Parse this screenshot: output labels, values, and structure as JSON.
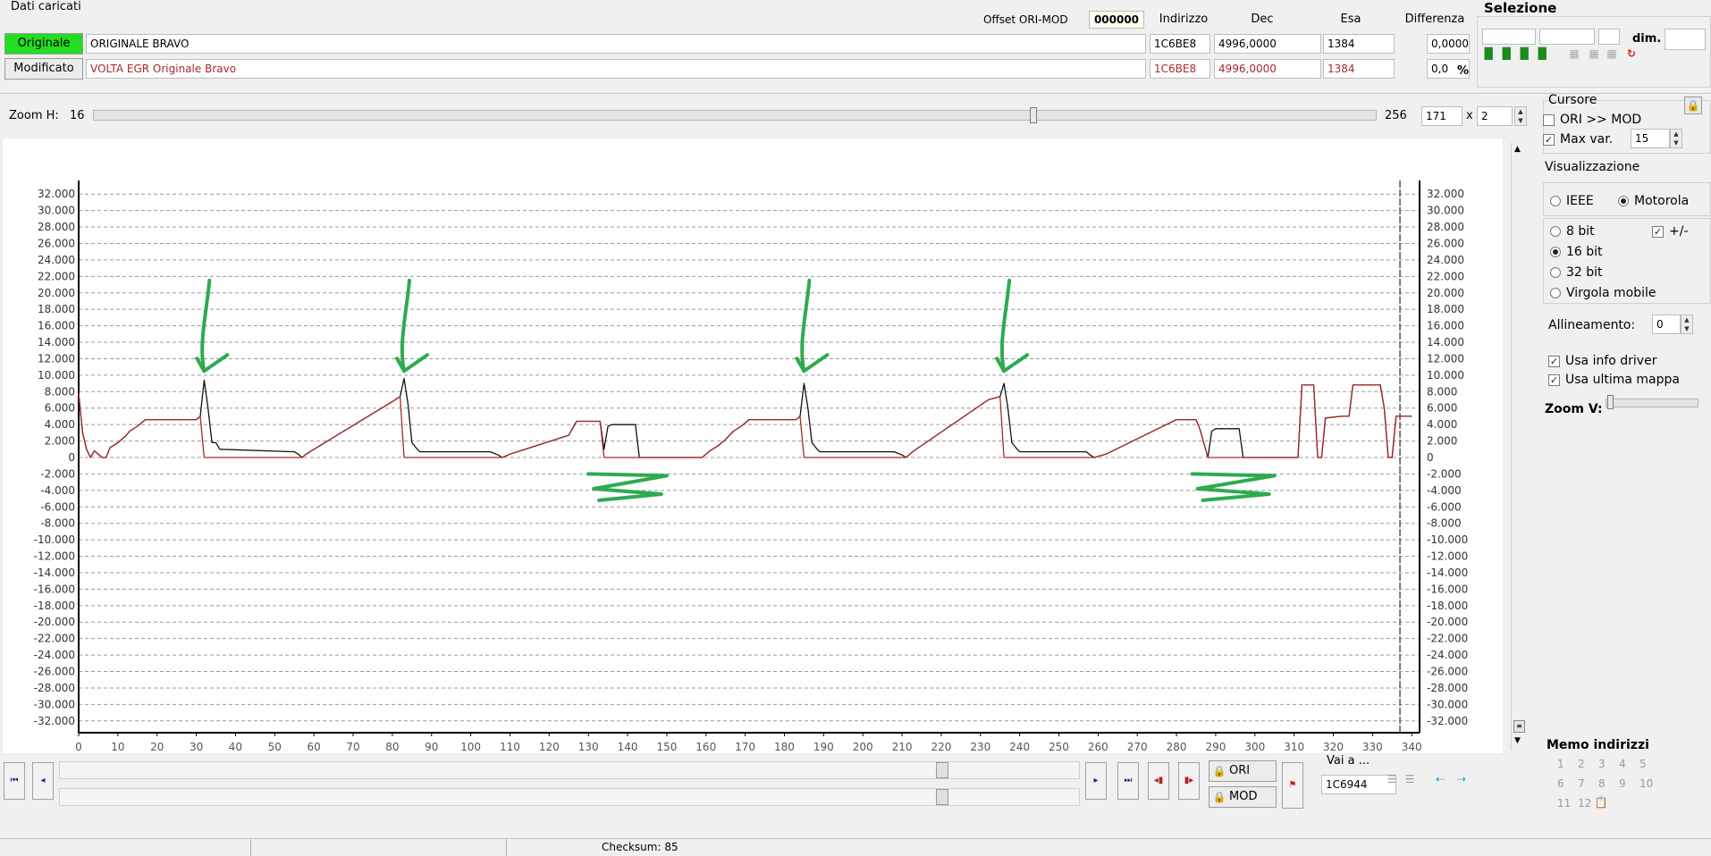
{
  "loaded": {
    "title": "Dati caricati",
    "offset_label": "Offset ORI-MOD",
    "offset_value": "000000",
    "headers": {
      "address": "Indirizzo",
      "dec": "Dec",
      "hex": "Esa",
      "diff": "Differenza"
    },
    "original": {
      "button": "Originale",
      "name": "ORIGINALE BRAVO",
      "address": "1C6BE8",
      "dec": "4996,0000",
      "hex": "1384",
      "diff": "0,0000"
    },
    "modified": {
      "button": "Modificato",
      "name": "VOLTA EGR Originale Bravo",
      "address": "1C6BE8",
      "dec": "4996,0000",
      "hex": "1384",
      "diff": "0,0",
      "unit": "%"
    }
  },
  "selection": {
    "title": "Selezione",
    "dim_label": "dim."
  },
  "zoom_h": {
    "label": "Zoom H:",
    "min": "16",
    "max": "256",
    "value": "171",
    "times": "x",
    "multiplier": "2",
    "level": 0.73
  },
  "cursor": {
    "title": "Cursore",
    "ori_mod": "ORI >> MOD",
    "ori_mod_checked": false,
    "max_var": "Max var.",
    "max_var_checked": true,
    "max_var_value": "15"
  },
  "visualization": {
    "title": "Visualizzazione",
    "ieee": "IEEE",
    "motorola": "Motorola",
    "byte_order": "Motorola",
    "bits": [
      "8 bit",
      "16 bit",
      "32 bit",
      "Virgola mobile"
    ],
    "selected_bits": "16 bit",
    "sign": "+/-",
    "sign_checked": true,
    "alignment_label": "Allineamento:",
    "alignment_value": "0",
    "use_driver": "Usa info driver",
    "use_driver_checked": true,
    "use_last_map": "Usa ultima mappa",
    "use_last_map_checked": true,
    "zoom_v": "Zoom V:"
  },
  "bottom": {
    "ori_button": "ORI",
    "mod_button": "MOD",
    "goto_label": "Vai a ...",
    "goto_value": "1C6944",
    "memo_title": "Memo indirizzi",
    "memo_slots": [
      "1",
      "2",
      "3",
      "4",
      "5",
      "6",
      "7",
      "8",
      "9",
      "10",
      "11",
      "12"
    ],
    "checksum": "Checksum: 85"
  },
  "chart_data": {
    "type": "line",
    "x_ticks": [
      0,
      10,
      20,
      30,
      40,
      50,
      60,
      70,
      80,
      90,
      100,
      110,
      120,
      130,
      140,
      150,
      160,
      170,
      180,
      190,
      200,
      210,
      220,
      230,
      240,
      250,
      260,
      270,
      280,
      290,
      300,
      310,
      320,
      330,
      340
    ],
    "y_ticks": [
      32000,
      30000,
      28000,
      26000,
      24000,
      22000,
      20000,
      18000,
      16000,
      14000,
      12000,
      10000,
      8000,
      6000,
      4000,
      2000,
      0,
      -2000,
      -4000,
      -6000,
      -8000,
      -10000,
      -12000,
      -14000,
      -16000,
      -18000,
      -20000,
      -22000,
      -24000,
      -26000,
      -28000,
      -30000,
      -32000
    ],
    "y_tick_labels": [
      "32.000",
      "30.000",
      "28.000",
      "26.000",
      "24.000",
      "22.000",
      "20.000",
      "18.000",
      "16.000",
      "14.000",
      "12.000",
      "10.000",
      "8.000",
      "6.000",
      "4.000",
      "2.000",
      "0",
      "-2.000",
      "-4.000",
      "-6.000",
      "-8.000",
      "-10.000",
      "-12.000",
      "-14.000",
      "-16.000",
      "-18.000",
      "-20.000",
      "-22.000",
      "-24.000",
      "-26.000",
      "-28.000",
      "-30.000",
      "-32.000"
    ],
    "xlim": [
      0,
      342
    ],
    "ylim": [
      -33000,
      33000
    ],
    "grid": true,
    "cursor_x": 337,
    "series": [
      {
        "color": "#111111",
        "points": [
          [
            0,
            7800
          ],
          [
            1,
            3000
          ],
          [
            2,
            1000
          ],
          [
            3,
            0
          ],
          [
            4,
            800
          ],
          [
            6,
            0
          ],
          [
            7,
            0
          ],
          [
            8,
            1200
          ],
          [
            10,
            1800
          ],
          [
            12,
            2600
          ],
          [
            13,
            3200
          ],
          [
            15,
            3800
          ],
          [
            17,
            4600
          ],
          [
            30,
            4600
          ],
          [
            31,
            5000
          ],
          [
            32,
            9400
          ],
          [
            33,
            6000
          ],
          [
            34,
            1800
          ],
          [
            35,
            1800
          ],
          [
            36,
            1000
          ],
          [
            55,
            700
          ],
          [
            56,
            400
          ],
          [
            57,
            0
          ],
          [
            58,
            400
          ],
          [
            60,
            1000
          ],
          [
            80,
            6800
          ],
          [
            82,
            7400
          ],
          [
            83,
            9600
          ],
          [
            84,
            6500
          ],
          [
            85,
            1800
          ],
          [
            86,
            1200
          ],
          [
            87,
            700
          ],
          [
            105,
            700
          ],
          [
            107,
            300
          ],
          [
            108,
            0
          ],
          [
            110,
            400
          ],
          [
            125,
            2700
          ],
          [
            127,
            4400
          ],
          [
            133,
            4400
          ],
          [
            134,
            1000
          ],
          [
            135,
            3800
          ],
          [
            136,
            4000
          ],
          [
            142,
            4000
          ],
          [
            143,
            0
          ],
          [
            147,
            0
          ],
          [
            153,
            0
          ],
          [
            159,
            0
          ],
          [
            161,
            800
          ],
          [
            163,
            1400
          ],
          [
            165,
            2200
          ],
          [
            167,
            3200
          ],
          [
            169,
            3800
          ],
          [
            171,
            4600
          ],
          [
            183,
            4600
          ],
          [
            184,
            5000
          ],
          [
            185,
            9000
          ],
          [
            186,
            6000
          ],
          [
            187,
            1800
          ],
          [
            188,
            1200
          ],
          [
            189,
            700
          ],
          [
            208,
            700
          ],
          [
            210,
            300
          ],
          [
            211,
            0
          ],
          [
            213,
            800
          ],
          [
            232,
            7000
          ],
          [
            235,
            7400
          ],
          [
            236,
            9000
          ],
          [
            237,
            6000
          ],
          [
            238,
            1800
          ],
          [
            239,
            1200
          ],
          [
            240,
            700
          ],
          [
            257,
            700
          ],
          [
            258,
            300
          ],
          [
            259,
            0
          ],
          [
            262,
            400
          ],
          [
            280,
            4600
          ],
          [
            285,
            4600
          ],
          [
            286,
            3400
          ],
          [
            288,
            0
          ],
          [
            289,
            3200
          ],
          [
            290,
            3500
          ],
          [
            296,
            3500
          ],
          [
            297,
            0
          ],
          [
            305,
            0
          ],
          [
            311,
            0
          ],
          [
            312,
            8800
          ],
          [
            315,
            8800
          ],
          [
            316,
            0
          ],
          [
            317,
            0
          ],
          [
            318,
            4800
          ],
          [
            322,
            5000
          ],
          [
            324,
            5000
          ],
          [
            325,
            8800
          ],
          [
            332,
            8800
          ],
          [
            333,
            6000
          ],
          [
            334,
            0
          ],
          [
            335,
            0
          ],
          [
            336,
            5000
          ],
          [
            340,
            5000
          ]
        ]
      },
      {
        "color": "#a52a2a",
        "points": [
          [
            0,
            7800
          ],
          [
            1,
            3000
          ],
          [
            2,
            1000
          ],
          [
            3,
            0
          ],
          [
            4,
            800
          ],
          [
            6,
            0
          ],
          [
            7,
            0
          ],
          [
            8,
            1200
          ],
          [
            10,
            1800
          ],
          [
            12,
            2600
          ],
          [
            13,
            3200
          ],
          [
            15,
            3800
          ],
          [
            17,
            4600
          ],
          [
            30,
            4600
          ],
          [
            31,
            5000
          ],
          [
            32,
            0
          ],
          [
            57,
            0
          ],
          [
            58,
            400
          ],
          [
            60,
            1000
          ],
          [
            80,
            6800
          ],
          [
            82,
            7400
          ],
          [
            83,
            0
          ],
          [
            108,
            0
          ],
          [
            110,
            400
          ],
          [
            125,
            2700
          ],
          [
            127,
            4400
          ],
          [
            133,
            4400
          ],
          [
            134,
            0
          ],
          [
            159,
            0
          ],
          [
            161,
            800
          ],
          [
            163,
            1400
          ],
          [
            165,
            2200
          ],
          [
            167,
            3200
          ],
          [
            169,
            3800
          ],
          [
            171,
            4600
          ],
          [
            183,
            4600
          ],
          [
            184,
            5000
          ],
          [
            185,
            0
          ],
          [
            211,
            0
          ],
          [
            213,
            800
          ],
          [
            232,
            7000
          ],
          [
            235,
            7400
          ],
          [
            236,
            0
          ],
          [
            259,
            0
          ],
          [
            262,
            400
          ],
          [
            280,
            4600
          ],
          [
            285,
            4600
          ],
          [
            286,
            3400
          ],
          [
            288,
            0
          ],
          [
            311,
            0
          ],
          [
            312,
            8800
          ],
          [
            315,
            8800
          ],
          [
            316,
            0
          ],
          [
            317,
            0
          ],
          [
            318,
            4800
          ],
          [
            322,
            5000
          ],
          [
            324,
            5000
          ],
          [
            325,
            8800
          ],
          [
            332,
            8800
          ],
          [
            333,
            6000
          ],
          [
            334,
            0
          ],
          [
            335,
            0
          ],
          [
            336,
            5000
          ],
          [
            340,
            5000
          ]
        ]
      }
    ]
  }
}
